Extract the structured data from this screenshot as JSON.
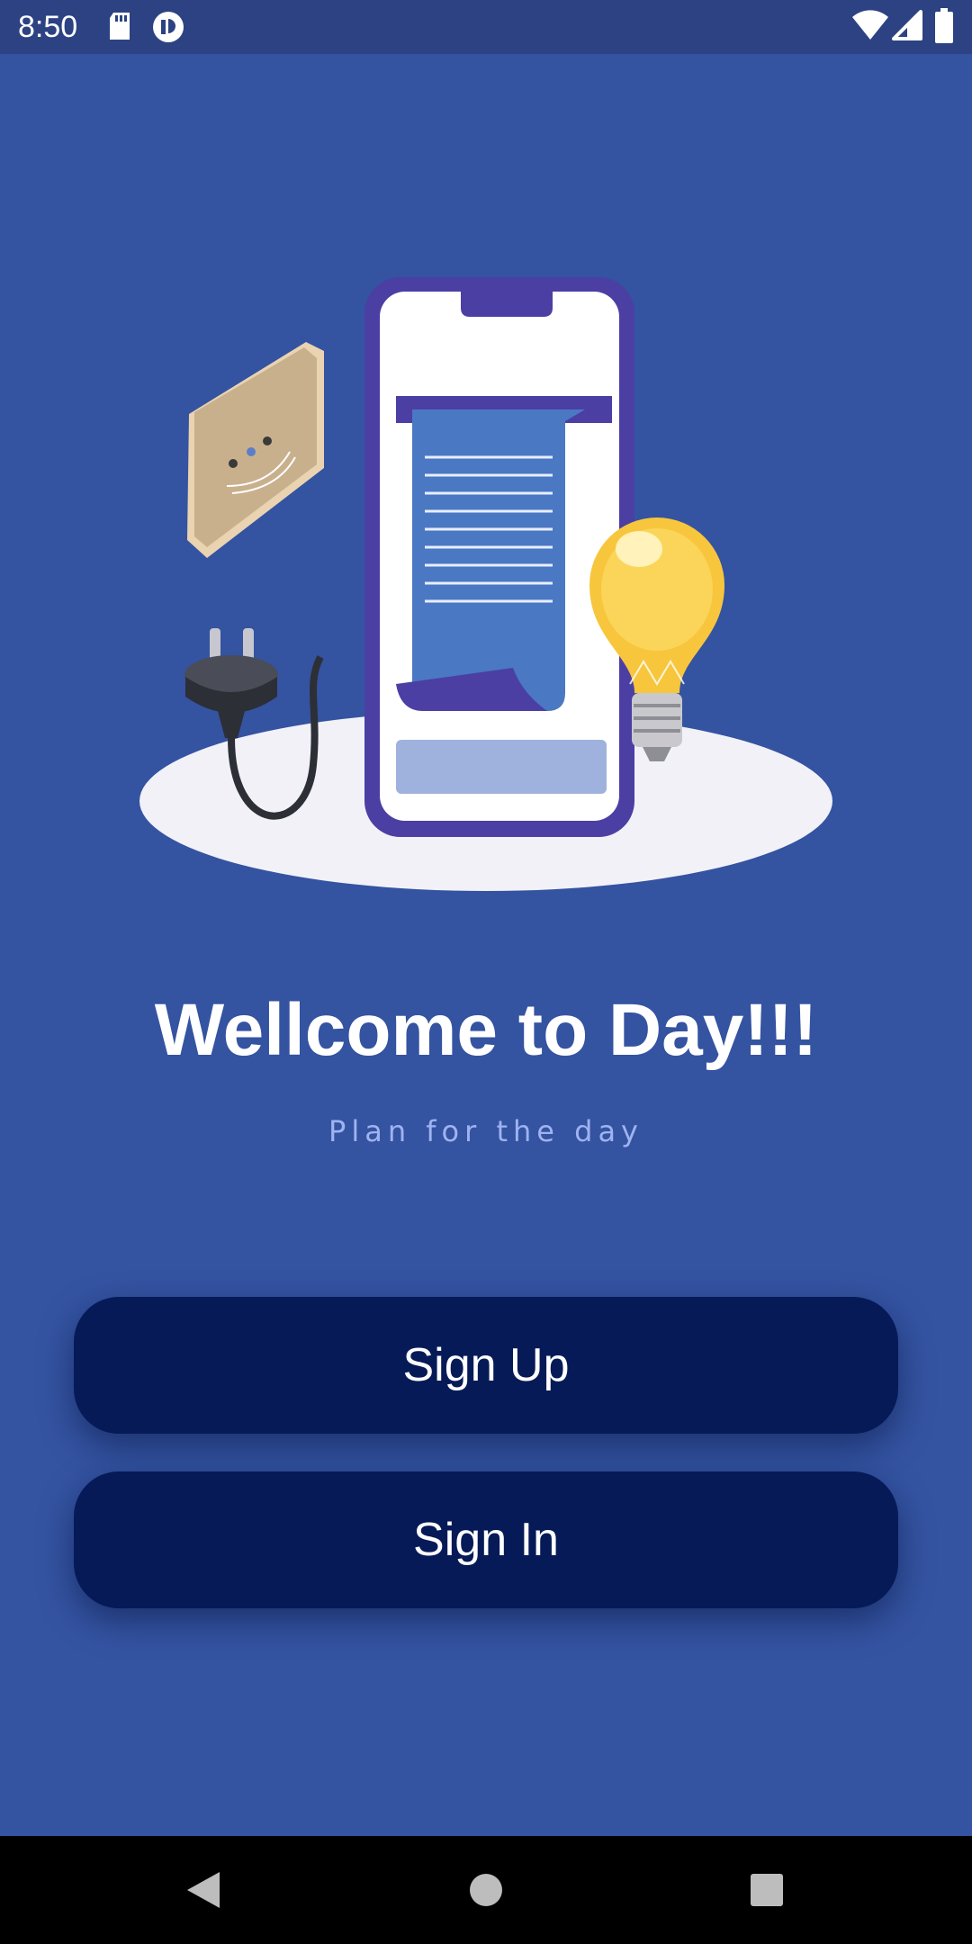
{
  "status_bar": {
    "time": "8:50",
    "left_icons": [
      "sd-card-icon",
      "app-notification-icon"
    ],
    "right_icons": [
      "wifi-icon",
      "signal-icon",
      "battery-icon"
    ]
  },
  "welcome": {
    "title": "Wellcome to Day!!!",
    "subtitle": "Plan for the day"
  },
  "buttons": {
    "sign_up": "Sign Up",
    "sign_in": "Sign In"
  },
  "navigation": {
    "icons": [
      "back-icon",
      "home-icon",
      "recents-icon"
    ]
  },
  "colors": {
    "background": "#3453a1",
    "status_bar": "#2c4283",
    "button": "#061a57",
    "subtitle": "#9fb3f0",
    "nav_bar": "#000000"
  }
}
